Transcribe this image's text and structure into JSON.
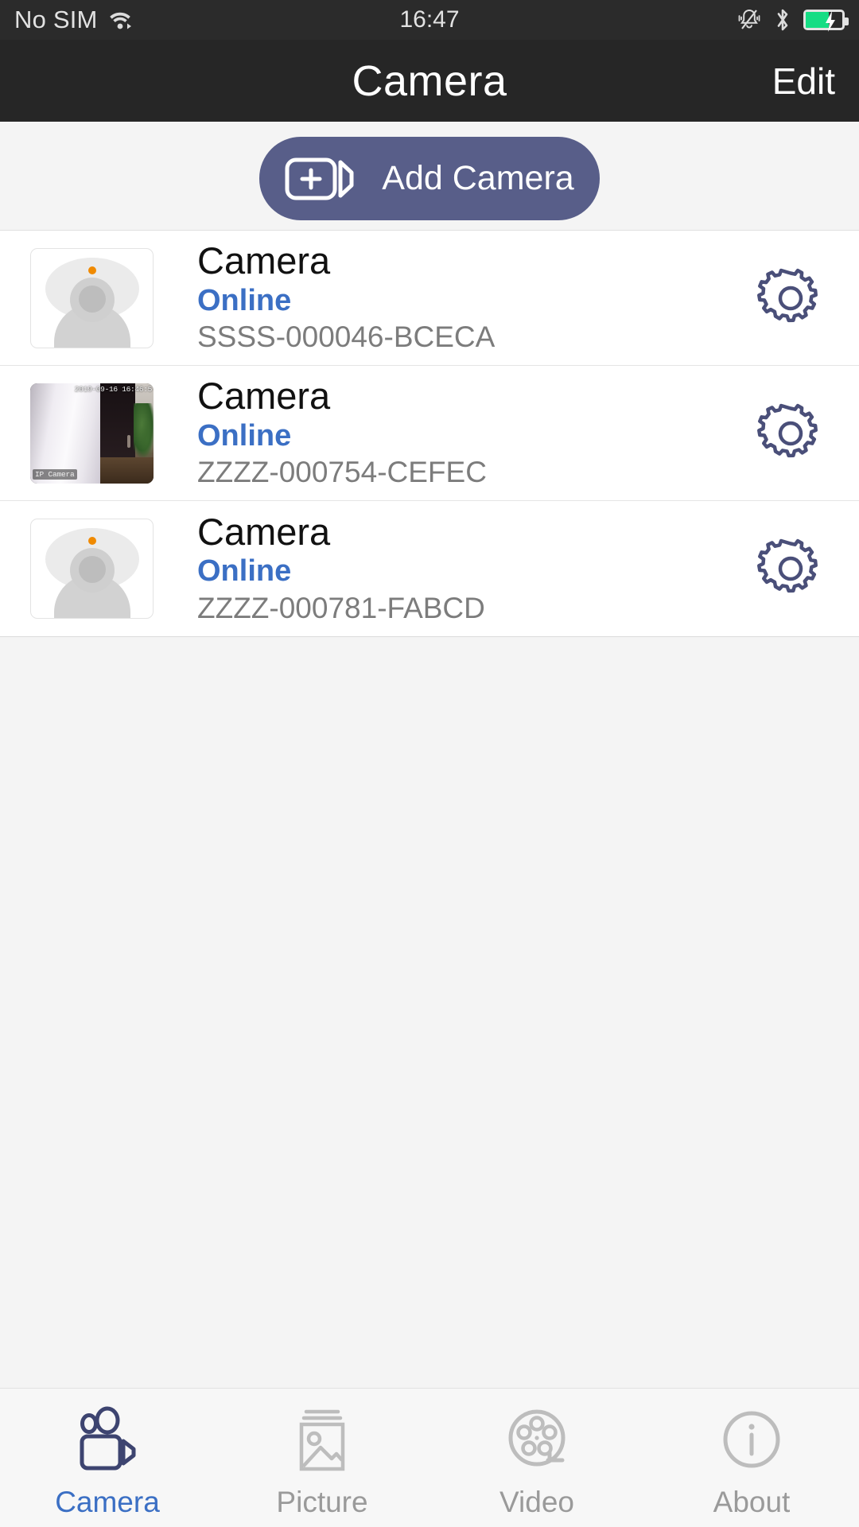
{
  "status_bar": {
    "carrier": "No SIM",
    "time": "16:47",
    "wifi_icon": "wifi-icon",
    "silent_icon": "bell-muted-icon",
    "bluetooth_icon": "bluetooth-icon",
    "battery_icon": "battery-charging-icon",
    "battery_level_pct": 62
  },
  "nav": {
    "title": "Camera",
    "edit_label": "Edit"
  },
  "add_camera": {
    "label": "Add Camera",
    "icon": "camcorder-plus-icon",
    "color": "#585e89"
  },
  "cameras": [
    {
      "name": "Camera",
      "status": "Online",
      "uid": "SSSS-000046-BCECA",
      "thumbnail": "placeholder",
      "settings_icon": "gear-icon"
    },
    {
      "name": "Camera",
      "status": "Online",
      "uid": "ZZZZ-000754-CEFEC",
      "thumbnail": "live-snapshot",
      "snapshot_timestamp": "2019-09-16 16:46:5",
      "snapshot_watermark": "IP Camera",
      "settings_icon": "gear-icon"
    },
    {
      "name": "Camera",
      "status": "Online",
      "uid": "ZZZZ-000781-FABCD",
      "thumbnail": "placeholder",
      "settings_icon": "gear-icon"
    }
  ],
  "tabs": [
    {
      "label": "Camera",
      "icon": "camcorder-icon",
      "active": true
    },
    {
      "label": "Picture",
      "icon": "image-icon",
      "active": false
    },
    {
      "label": "Video",
      "icon": "film-reel-icon",
      "active": false
    },
    {
      "label": "About",
      "icon": "info-circle-icon",
      "active": false
    }
  ],
  "colors": {
    "accent": "#3b6fc4",
    "button": "#585e89",
    "navbar": "#262626",
    "status_online": "#3b6fc4"
  }
}
